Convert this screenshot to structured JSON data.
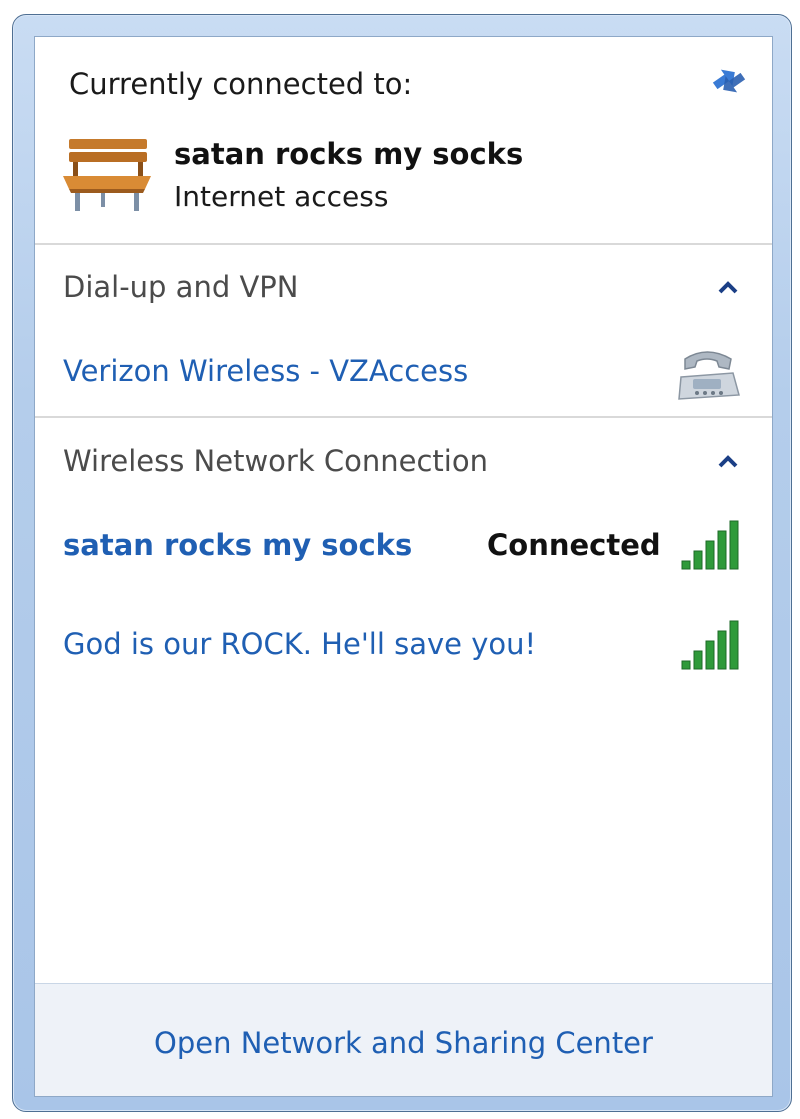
{
  "current": {
    "heading": "Currently connected to:",
    "network_name": "satan rocks my socks",
    "network_status": "Internet access",
    "network_icon": "bench-icon",
    "refresh_icon": "refresh-arrows-icon"
  },
  "dialup": {
    "title": "Dial-up and VPN",
    "collapse_icon": "chevron-up-icon",
    "items": [
      {
        "label": "Verizon Wireless - VZAccess",
        "icon": "telephone-icon"
      }
    ]
  },
  "wireless": {
    "title": "Wireless Network Connection",
    "collapse_icon": "chevron-up-icon",
    "items": [
      {
        "label": "satan rocks my socks",
        "status": "Connected",
        "signal_bars": 5
      },
      {
        "label": "God is our ROCK. He'll save you!",
        "status": "",
        "signal_bars": 5
      }
    ]
  },
  "footer": {
    "link": "Open Network and Sharing Center"
  },
  "colors": {
    "link": "#1f5fb3",
    "signal_green": "#2f9a3a",
    "frame": "#b4cdeb"
  }
}
